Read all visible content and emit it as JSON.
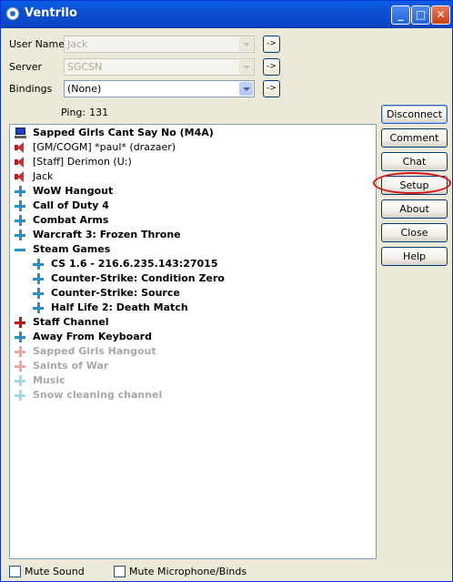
{
  "window": {
    "title": "Ventrilo"
  },
  "form": {
    "user_name_label": "User Name",
    "user_name_value": "Jack",
    "server_label": "Server",
    "server_value": "SGCSN",
    "bindings_label": "Bindings",
    "bindings_value": "(None)",
    "arrow_button_label": "->",
    "ping_label": "Ping:",
    "ping_value": "131"
  },
  "buttons": {
    "disconnect": "Disconnect",
    "comment": "Comment",
    "chat": "Chat",
    "setup": "Setup",
    "about": "About",
    "close": "Close",
    "help": "Help"
  },
  "tree": {
    "items": [
      {
        "label": "Sapped Girls Cant Say No (M4A)",
        "icon": "server-icon"
      },
      {
        "label": "[GM/COGM] *paul* (drazaer)",
        "icon": "speaker-icon"
      },
      {
        "label": "[Staff] Derimon (U:)",
        "icon": "speaker-icon"
      },
      {
        "label": "Jack",
        "icon": "speaker-icon"
      },
      {
        "label": "WoW Hangout",
        "icon": "plus-icon"
      },
      {
        "label": "Call of Duty 4",
        "icon": "plus-icon"
      },
      {
        "label": "Combat Arms",
        "icon": "plus-icon"
      },
      {
        "label": "Warcraft 3: Frozen Throne",
        "icon": "plus-icon"
      },
      {
        "label": "Steam Games",
        "icon": "minus-icon"
      },
      {
        "label": "CS 1.6 - 216.6.235.143:27015",
        "icon": "plus-icon"
      },
      {
        "label": "Counter-Strike: Condition Zero",
        "icon": "plus-icon"
      },
      {
        "label": "Counter-Strike: Source",
        "icon": "plus-icon"
      },
      {
        "label": "Half Life 2: Death Match",
        "icon": "plus-icon"
      },
      {
        "label": "Staff Channel",
        "icon": "red-plus-icon"
      },
      {
        "label": "Away From Keyboard",
        "icon": "plus-icon"
      },
      {
        "label": "Sapped Girls Hangout",
        "icon": "pink-plus-icon"
      },
      {
        "label": "Saints of War",
        "icon": "pink-plus-icon"
      },
      {
        "label": "Music",
        "icon": "light-plus-icon"
      },
      {
        "label": "Snow cleaning channel",
        "icon": "light-plus-icon"
      }
    ]
  },
  "footer": {
    "mute_sound_label": "Mute Sound",
    "mute_mic_label": "Mute Microphone/Binds"
  },
  "colors": {
    "titlebar": "#0a5ee6",
    "window_bg": "#ece9d8",
    "annotation_circle": "#d21414",
    "channel_icon": "#2a8ec8"
  }
}
